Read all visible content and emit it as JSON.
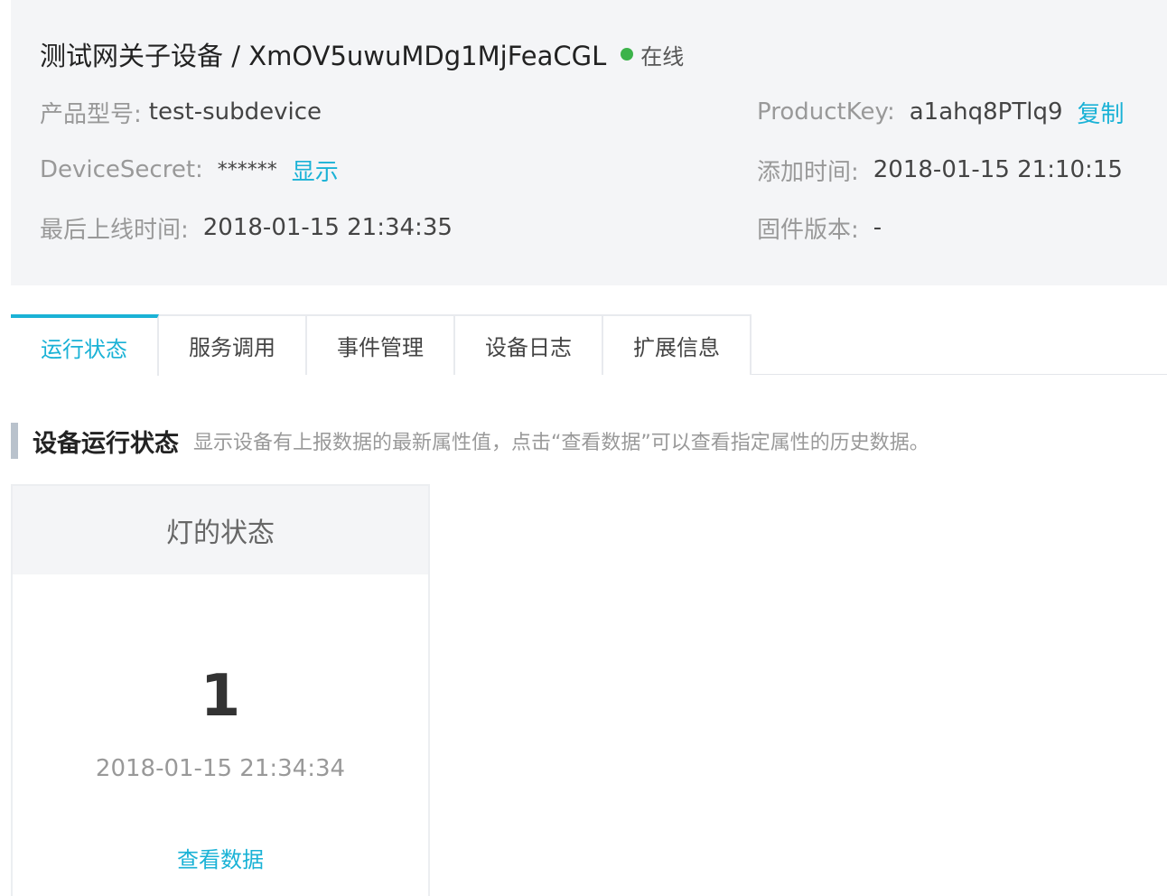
{
  "header": {
    "device_title": "测试网关子设备 / XmOV5uwuMDg1MjFeaCGL",
    "status_text": "在线",
    "status_color": "#3cb34a"
  },
  "fields": {
    "product_model_label": "产品型号:",
    "product_model_value": "test-subdevice",
    "device_secret_label": "DeviceSecret:",
    "device_secret_value": "******",
    "device_secret_action": "显示",
    "last_online_label": "最后上线时间:",
    "last_online_value": "2018-01-15 21:34:35",
    "product_key_label": "ProductKey:",
    "product_key_value": "a1ahq8PTlq9",
    "product_key_action": "复制",
    "added_time_label": "添加时间:",
    "added_time_value": "2018-01-15 21:10:15",
    "firmware_label": "固件版本:",
    "firmware_value": "-"
  },
  "tabs": [
    {
      "label": "运行状态",
      "active": true
    },
    {
      "label": "服务调用"
    },
    {
      "label": "事件管理"
    },
    {
      "label": "设备日志"
    },
    {
      "label": "扩展信息"
    }
  ],
  "section": {
    "title": "设备运行状态",
    "description": "显示设备有上报数据的最新属性值，点击“查看数据”可以查看指定属性的历史数据。"
  },
  "card": {
    "title": "灯的状态",
    "value": "1",
    "time": "2018-01-15 21:34:34",
    "link": "查看数据"
  },
  "colors": {
    "accent": "#1ab2d6"
  }
}
